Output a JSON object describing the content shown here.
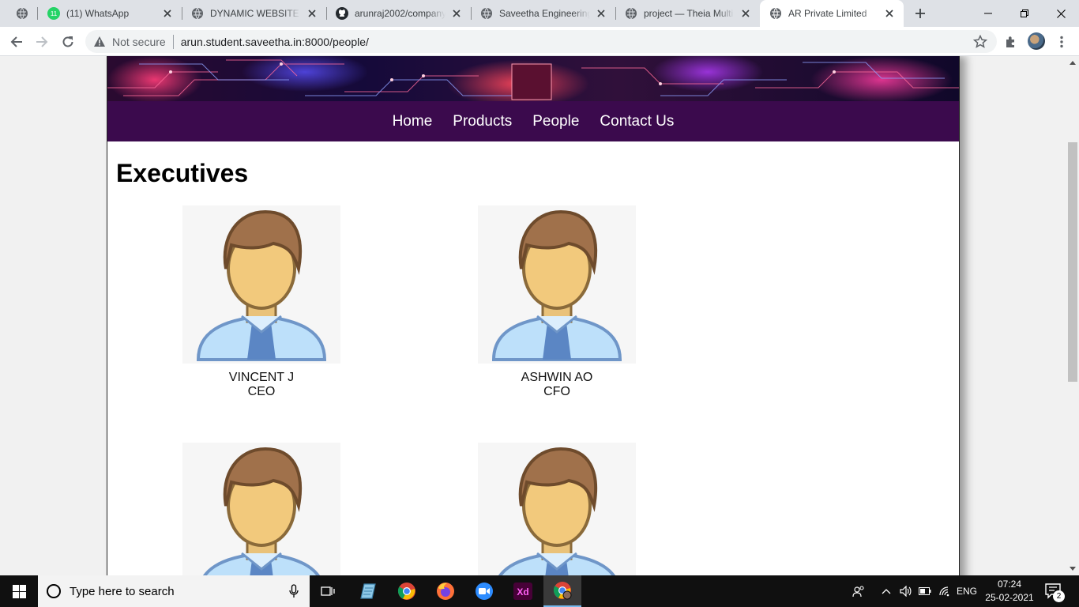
{
  "browser": {
    "tabs": [
      {
        "title": "",
        "icon": "globe-icon"
      },
      {
        "title": "(11) WhatsApp",
        "icon": "whatsapp-icon",
        "badge": "11"
      },
      {
        "title": "DYNAMIC WEBSITE AR",
        "icon": "globe-icon"
      },
      {
        "title": "arunraj2002/company",
        "icon": "github-icon"
      },
      {
        "title": "Saveetha Engineering",
        "icon": "globe-icon"
      },
      {
        "title": "project — Theia Multi",
        "icon": "globe-icon"
      },
      {
        "title": "AR Private Limited",
        "icon": "globe-icon",
        "active": true
      }
    ],
    "security_label": "Not secure",
    "url": "arun.student.saveetha.in:8000/people/"
  },
  "site": {
    "nav": [
      "Home",
      "Products",
      "People",
      "Contact Us"
    ],
    "heading": "Executives",
    "people": [
      {
        "name": "VINCENT J",
        "role": "CEO"
      },
      {
        "name": "ASHWIN AO",
        "role": "CFO"
      },
      {
        "name": "",
        "role": ""
      },
      {
        "name": "",
        "role": ""
      }
    ]
  },
  "taskbar": {
    "search_placeholder": "Type here to search",
    "language": "ENG",
    "time": "07:24",
    "date": "25-02-2021",
    "notification_count": "2",
    "apps": [
      "task-view-icon",
      "file-app-icon",
      "chrome-icon",
      "firefox-icon",
      "zoom-icon",
      "adobe-xd-icon",
      "chrome-profile-icon"
    ]
  },
  "colors": {
    "nav_bg": "#3b0a4d",
    "nav_text": "#ffffff",
    "tab_strip": "#dee1e6",
    "taskbar": "#101010"
  }
}
